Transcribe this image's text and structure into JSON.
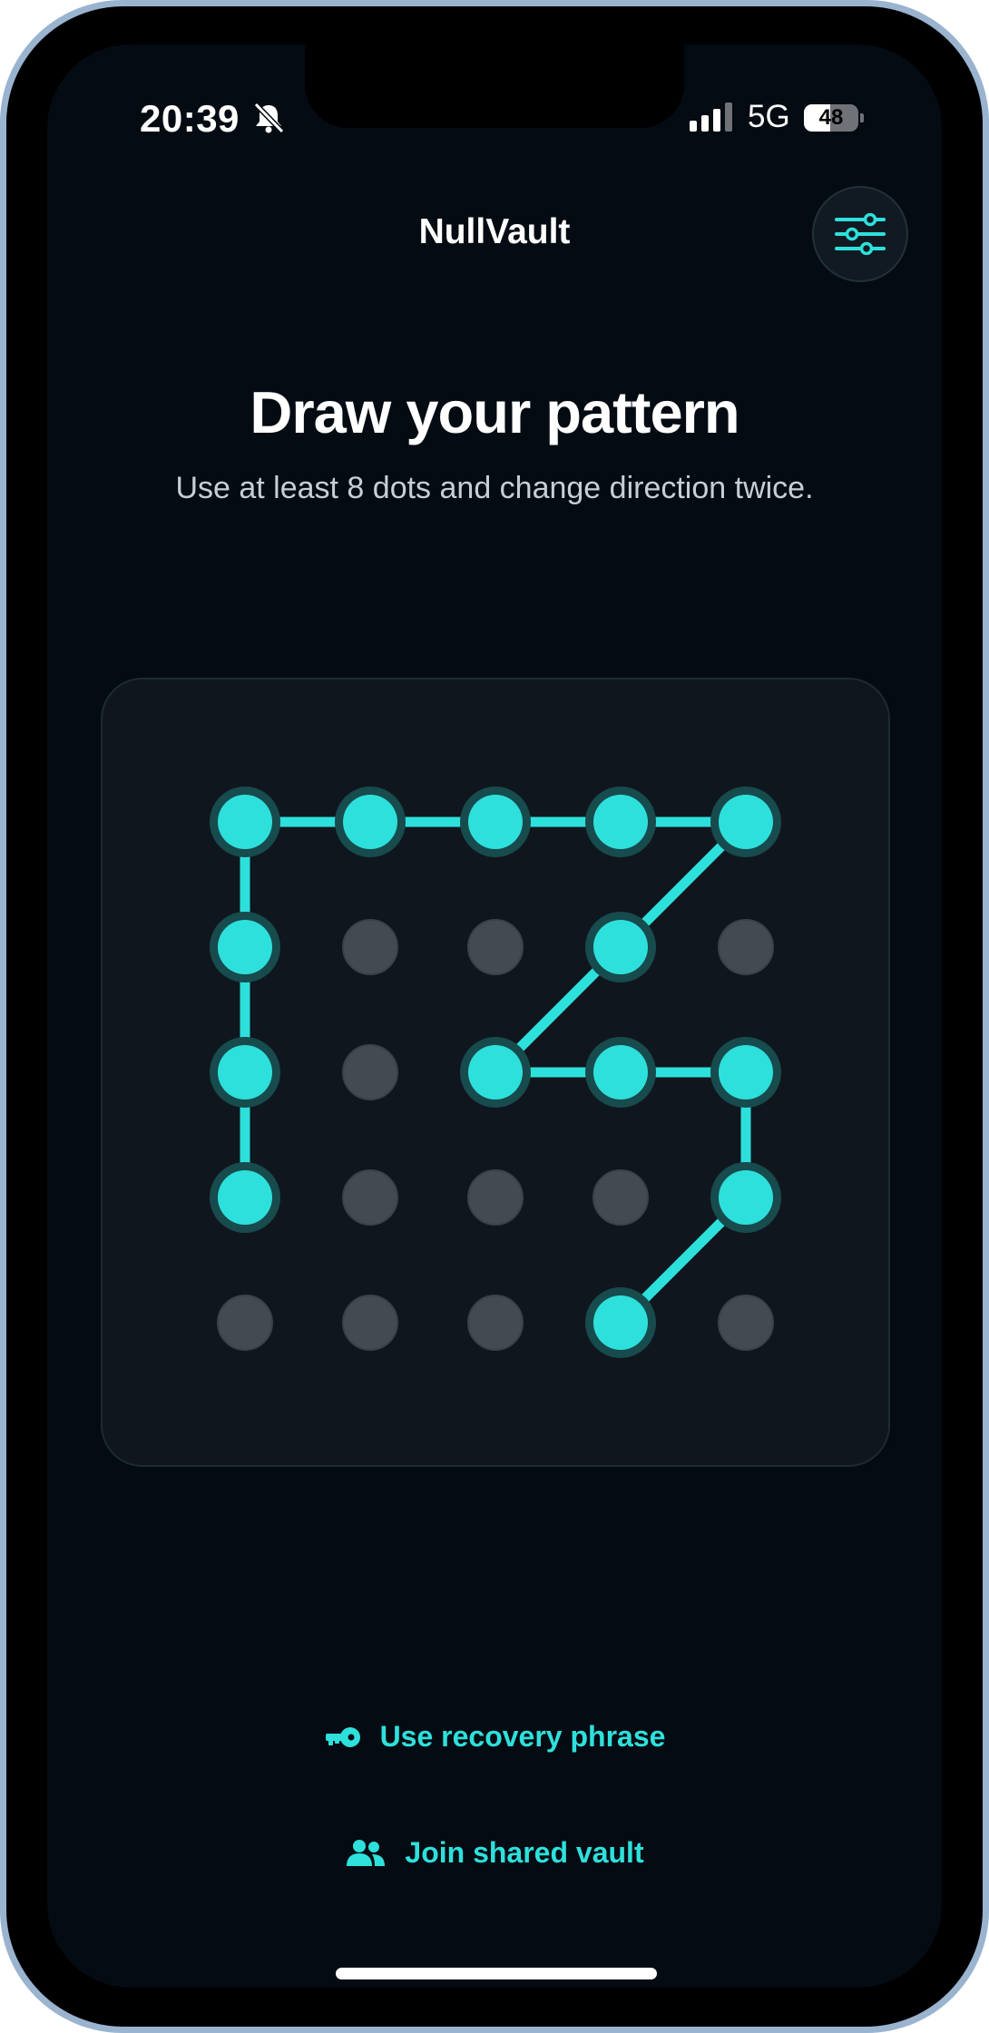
{
  "status_bar": {
    "time": "20:39",
    "network": "5G",
    "battery_level": "48",
    "battery_fraction": 0.48
  },
  "header": {
    "app_title": "NullVault"
  },
  "prompt": {
    "heading": "Draw your pattern",
    "subheading": "Use at least 8 dots and change direction twice."
  },
  "pattern": {
    "rows": 5,
    "cols": 5,
    "path": [
      [
        4,
        3
      ],
      [
        3,
        4
      ],
      [
        2,
        4
      ],
      [
        2,
        3
      ],
      [
        2,
        2
      ],
      [
        1,
        3
      ],
      [
        0,
        4
      ],
      [
        0,
        3
      ],
      [
        0,
        2
      ],
      [
        0,
        1
      ],
      [
        0,
        0
      ],
      [
        1,
        0
      ],
      [
        2,
        0
      ],
      [
        3,
        0
      ]
    ]
  },
  "links": {
    "recovery_phrase": "Use recovery phrase",
    "join_shared_vault": "Join shared vault"
  },
  "colors": {
    "accent": "#2ee0dc",
    "background": "#040b12",
    "inactive_dot": "#434a52",
    "frame": "#9ab3cf"
  }
}
